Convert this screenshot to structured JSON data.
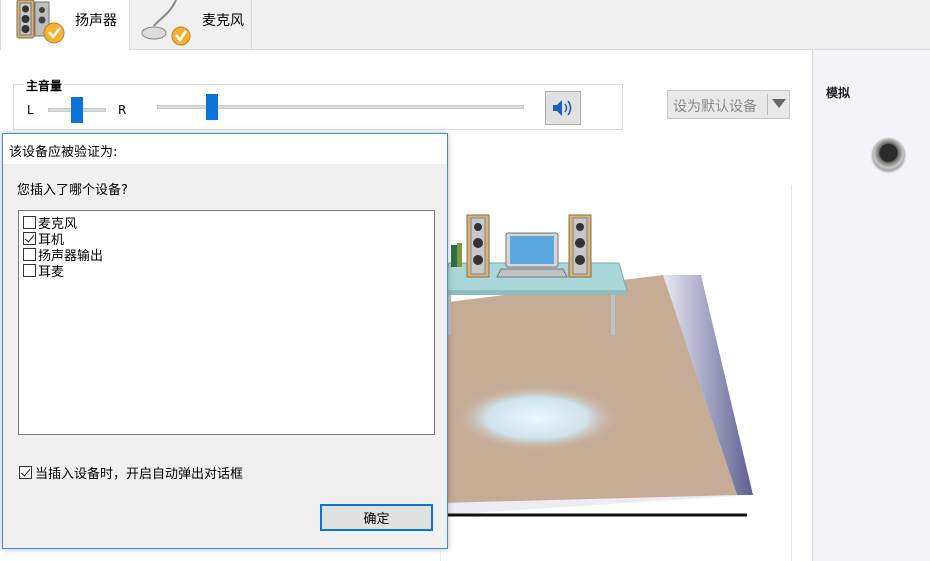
{
  "tabs": [
    {
      "label": "扬声器",
      "icon": "speaker-icon",
      "active": true
    },
    {
      "label": "麦克风",
      "icon": "microphone-icon",
      "active": false
    }
  ],
  "master_volume": {
    "title": "主音量",
    "balance_left": "L",
    "balance_right": "R",
    "balance_level": 0.5,
    "volume_level": 0.15,
    "mute_icon": "speaker-volume-icon"
  },
  "default_device": {
    "label": "设为默认设备"
  },
  "side_panel": {
    "label": "模拟",
    "jack_icon": "audio-jack-icon"
  },
  "dialog": {
    "title": "该设备应被验证为:",
    "question": "您插入了哪个设备?",
    "options": [
      {
        "label": "麦克风",
        "checked": false
      },
      {
        "label": "耳机",
        "checked": true
      },
      {
        "label": "扬声器输出",
        "checked": false
      },
      {
        "label": "耳麦",
        "checked": false
      }
    ],
    "auto_popup_label": "当插入设备时，开启自动弹出对话框",
    "auto_popup_checked": true,
    "ok_label": "确定"
  },
  "colors": {
    "accent": "#0a74da",
    "dialog_border": "#3d8fd6"
  }
}
